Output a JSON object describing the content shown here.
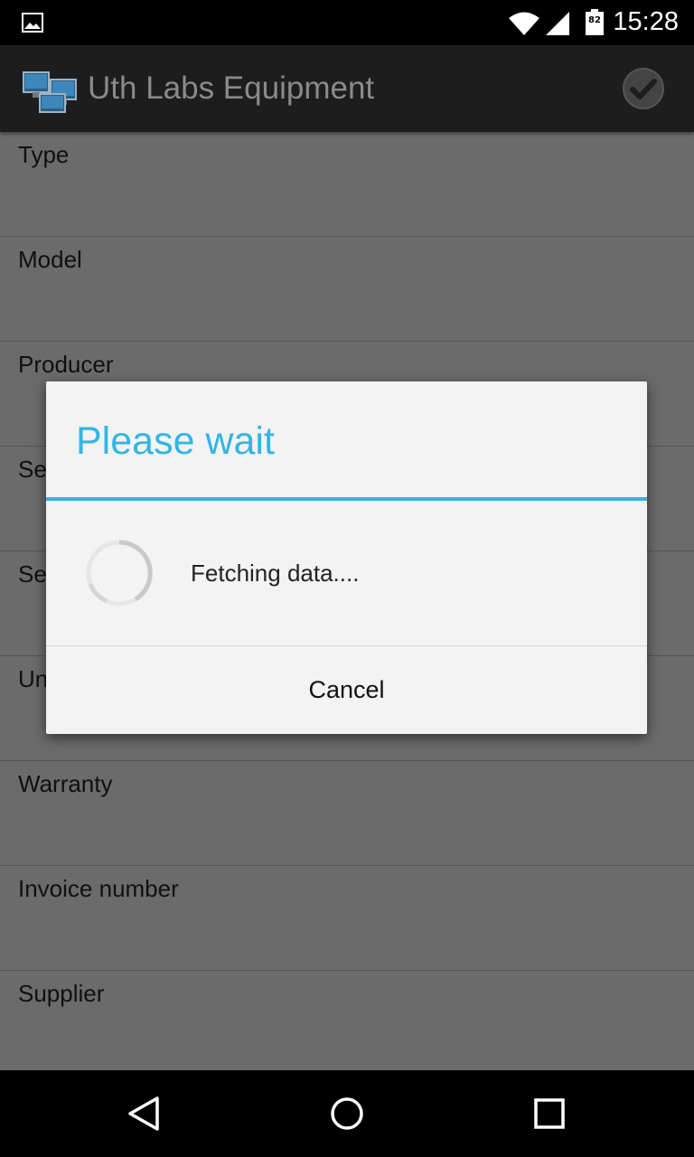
{
  "status_bar": {
    "time": "15:28",
    "battery_level": "82",
    "icons": [
      "gallery-icon",
      "wifi-icon",
      "signal-icon",
      "battery-icon"
    ]
  },
  "action_bar": {
    "title": "Uth Labs Equipment",
    "icons": [
      "app-logo-icon",
      "checkmark-icon"
    ]
  },
  "form": {
    "rows": [
      {
        "label": "Type"
      },
      {
        "label": "Model"
      },
      {
        "label": "Producer"
      },
      {
        "label": "Se"
      },
      {
        "label": "Se"
      },
      {
        "label": "Un"
      },
      {
        "label": "Warranty"
      },
      {
        "label": "Invoice number"
      },
      {
        "label": "Supplier"
      }
    ]
  },
  "dialog": {
    "title": "Please wait",
    "message": "Fetching data....",
    "cancel_label": "Cancel",
    "accent_color": "#33b5e5"
  },
  "nav_bar": {
    "icons": [
      "back-icon",
      "home-icon",
      "recents-icon"
    ]
  }
}
